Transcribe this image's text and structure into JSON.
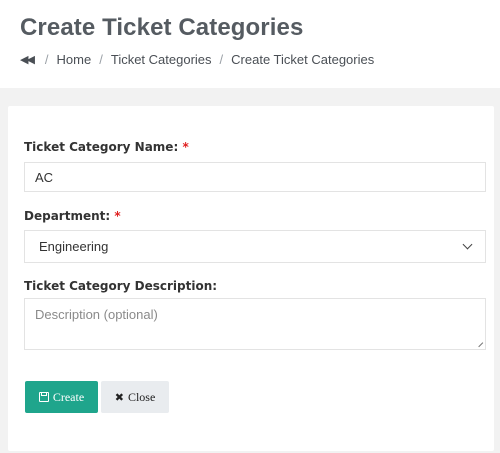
{
  "header": {
    "title": "Create Ticket Categories",
    "breadcrumb": {
      "back_icon": "double-chevron-left-icon",
      "items": [
        "Home",
        "Ticket Categories",
        "Create Ticket Categories"
      ],
      "separator": "/"
    }
  },
  "form": {
    "name": {
      "label": "Ticket Category Name:",
      "required_marker": "*",
      "value": "AC"
    },
    "department": {
      "label": "Department:",
      "required_marker": "*",
      "selected": "Engineering"
    },
    "description": {
      "label": "Ticket Category Description:",
      "placeholder": "Description (optional)"
    },
    "buttons": {
      "create_label": "Create",
      "create_icon": "save-icon",
      "close_label": "Close",
      "close_icon": "close-icon"
    }
  },
  "colors": {
    "primary_button": "#1fa58c",
    "secondary_button": "#e9ecef",
    "required": "#e02020",
    "background": "#f2f2f2"
  }
}
